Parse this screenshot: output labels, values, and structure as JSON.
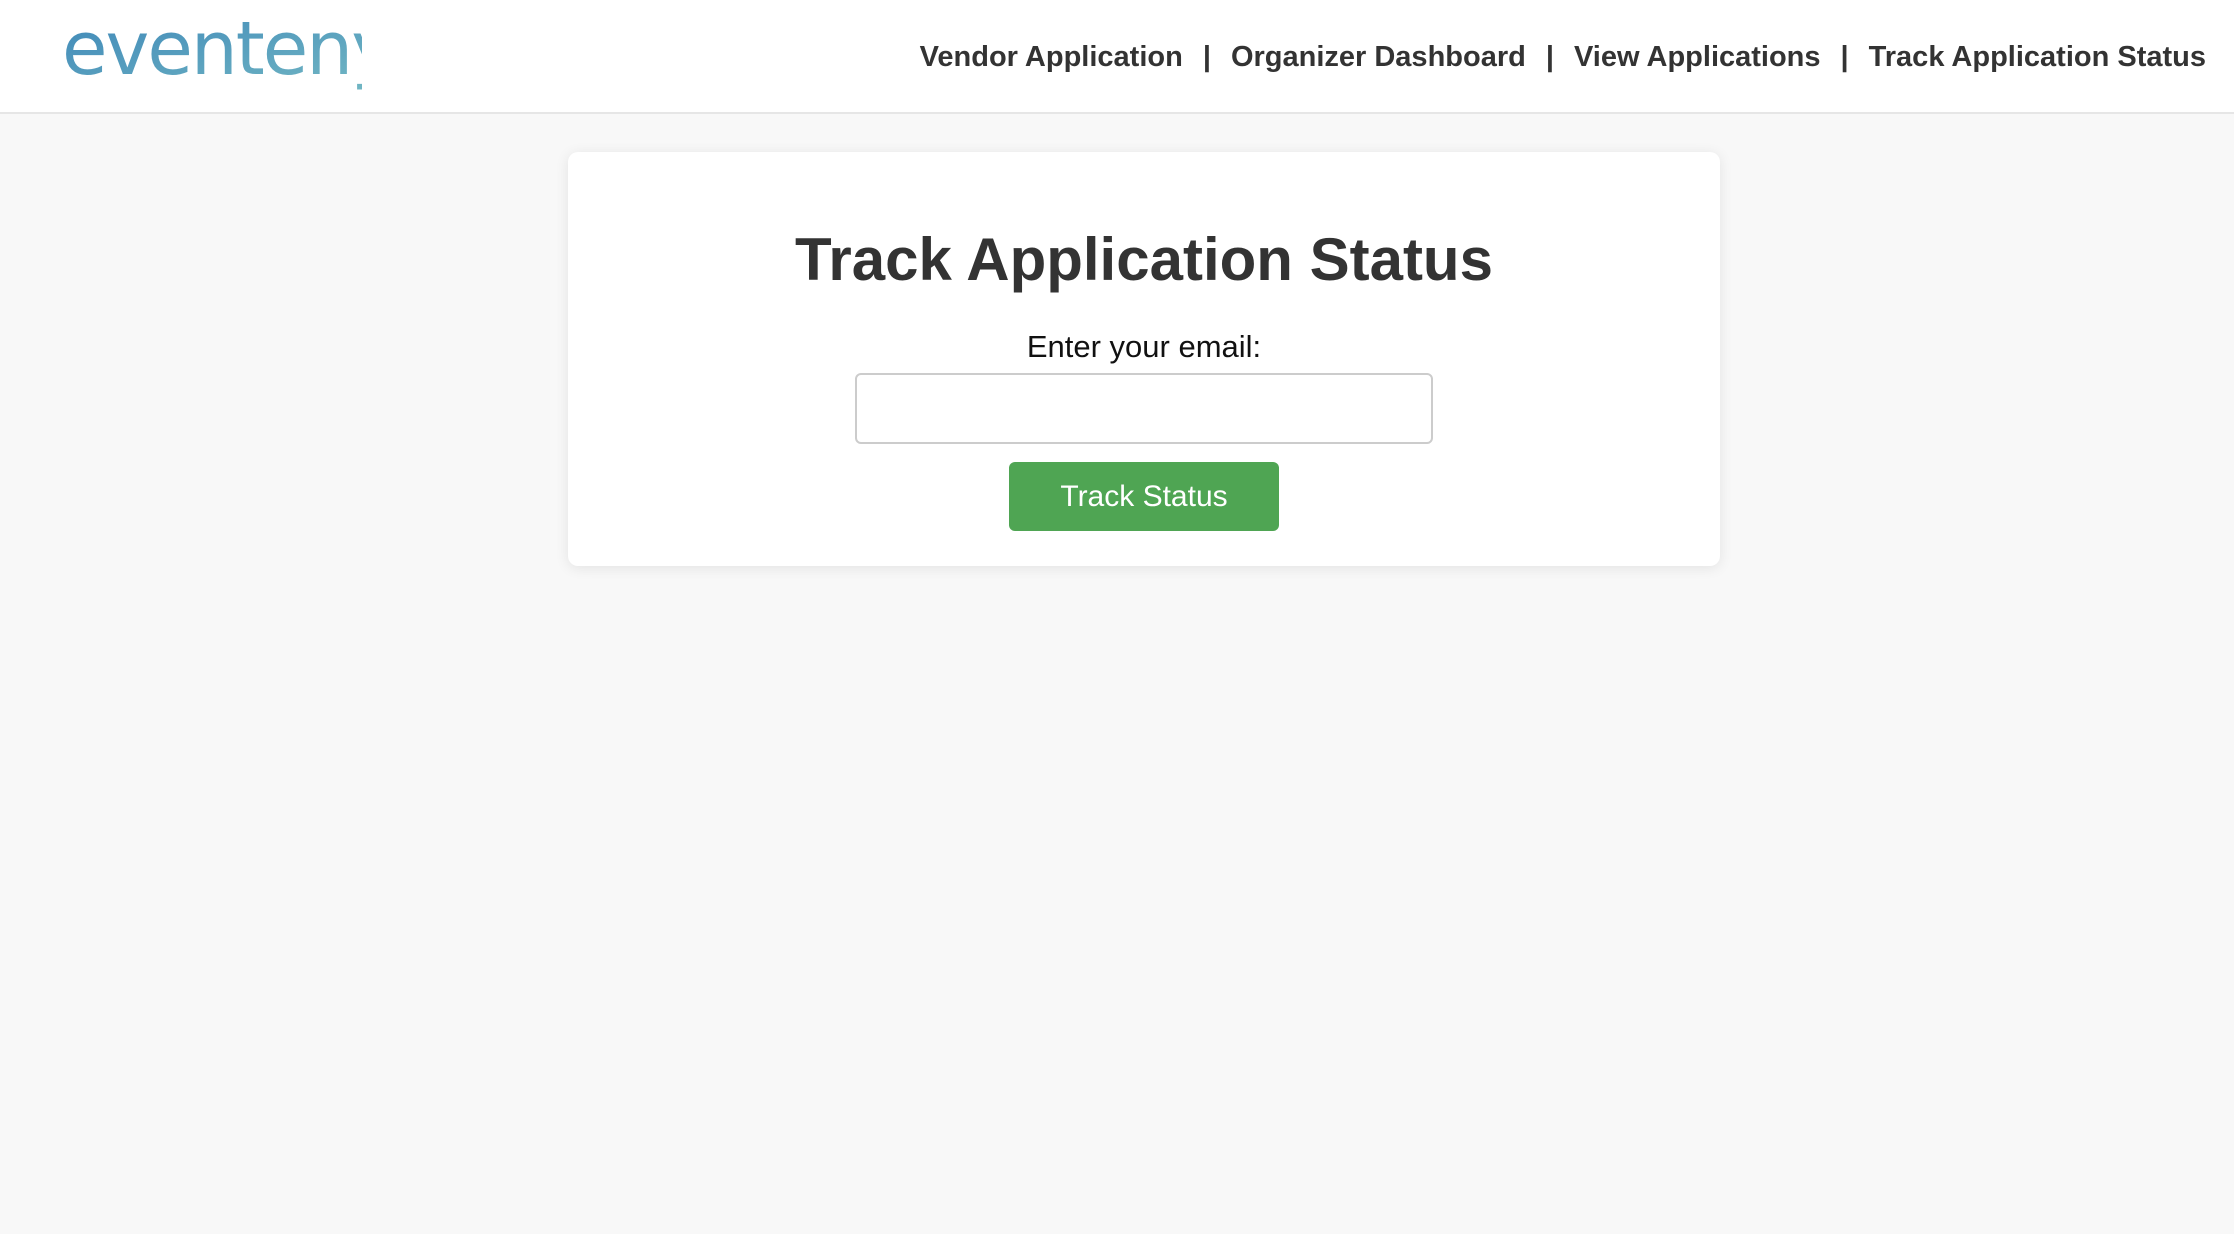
{
  "header": {
    "logo_text": "eventeny",
    "nav": [
      {
        "label": "Vendor Application"
      },
      {
        "label": "Organizer Dashboard"
      },
      {
        "label": "View Applications"
      },
      {
        "label": "Track Application Status"
      }
    ],
    "separator": "|"
  },
  "main": {
    "title": "Track Application Status",
    "email_label": "Enter your email:",
    "email_value": "",
    "submit_label": "Track Status"
  },
  "colors": {
    "background": "#f8f8f8",
    "button": "#4fa553",
    "logo_gradient_start": "#3a7bb0",
    "logo_gradient_end": "#6fb3c0"
  }
}
